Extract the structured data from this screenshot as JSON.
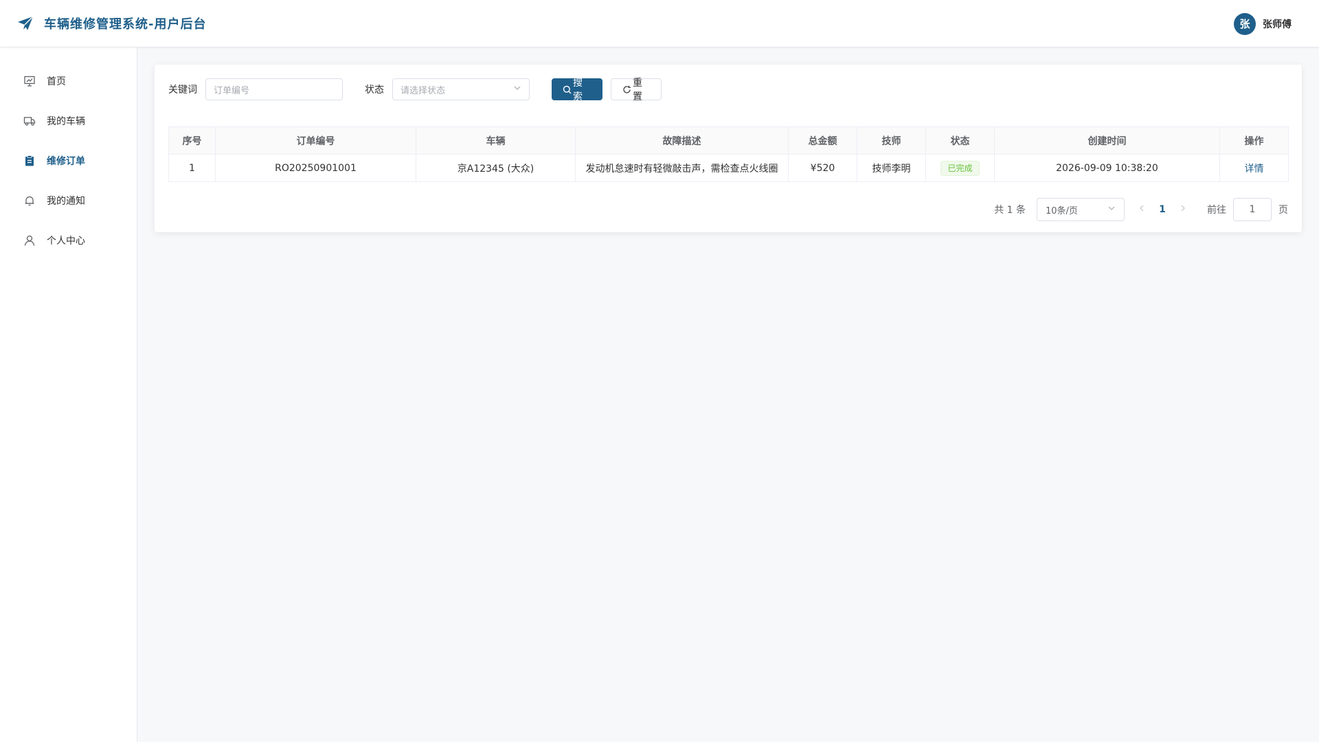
{
  "app": {
    "title": "车辆维修管理系统-用户后台",
    "brand_icon": "paper-plane-icon",
    "accent_color": "#1f5f8b"
  },
  "user": {
    "avatar_letter": "张",
    "name": "张师傅"
  },
  "sidebar": {
    "items": [
      {
        "label": "首页",
        "icon": "presentation-board-icon",
        "active": false
      },
      {
        "label": "我的车辆",
        "icon": "truck-icon",
        "active": false
      },
      {
        "label": "维修订单",
        "icon": "clipboard-icon",
        "active": true
      },
      {
        "label": "我的通知",
        "icon": "bell-icon",
        "active": false
      },
      {
        "label": "个人中心",
        "icon": "user-icon",
        "active": false
      }
    ]
  },
  "filters": {
    "keyword_label": "关键词",
    "keyword_placeholder": "订单编号",
    "status_label": "状态",
    "status_placeholder": "请选择状态",
    "search_label": "搜索",
    "reset_label": "重置"
  },
  "table": {
    "columns": [
      "序号",
      "订单编号",
      "车辆",
      "故障描述",
      "总金额",
      "技师",
      "状态",
      "创建时间",
      "操作"
    ],
    "rows": [
      {
        "index": "1",
        "order_no": "RO20250901001",
        "vehicle": "京A12345 (大众)",
        "fault": "发动机怠速时有轻微敲击声，需检查点火线圈",
        "amount": "¥520",
        "technician": "技师李明",
        "status": "已完成",
        "created_at": "2026-09-09 10:38:20",
        "action": "详情"
      }
    ]
  },
  "pagination": {
    "total_text": "共 1 条",
    "page_size": "10条/页",
    "current_page": "1",
    "goto_label": "前往",
    "goto_value": "1",
    "goto_unit": "页"
  }
}
